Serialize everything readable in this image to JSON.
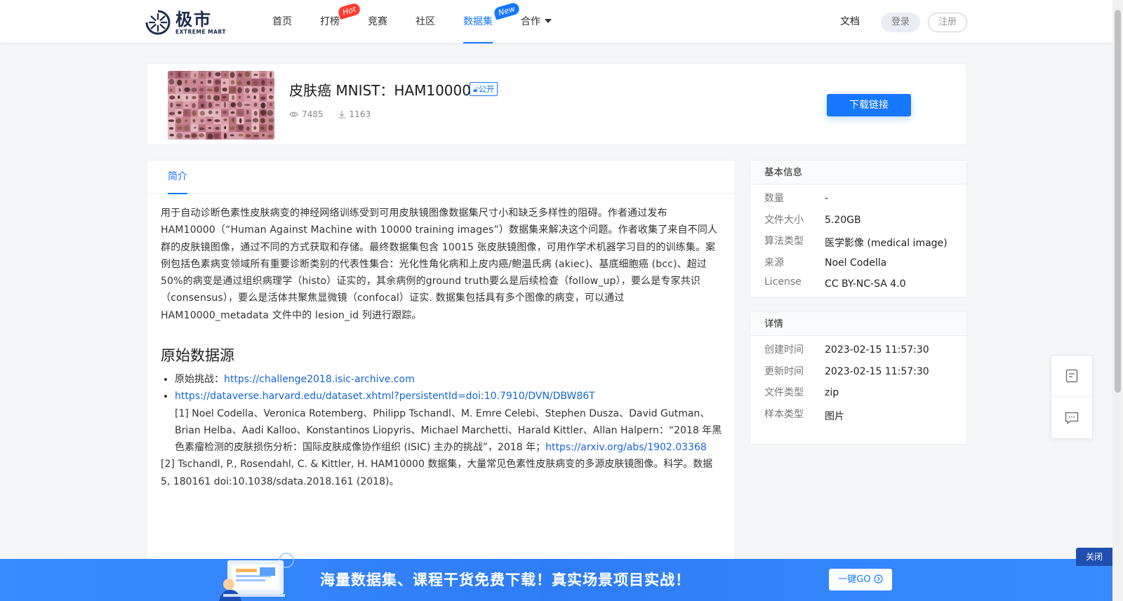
{
  "header": {
    "logo_cn": "极市",
    "logo_en": "EXTREME MART",
    "nav": [
      {
        "label": "首页"
      },
      {
        "label": "打榜",
        "badge": "Hot"
      },
      {
        "label": "竞赛"
      },
      {
        "label": "社区"
      },
      {
        "label": "数据集",
        "badge": "New",
        "active": true
      },
      {
        "label": "合作"
      }
    ],
    "docs": "文档",
    "login": "登录",
    "register": "注册"
  },
  "dataset": {
    "title": "皮肤癌 MNIST：HAM10000",
    "public_tag": "公开",
    "views": "7485",
    "downloads": "1163",
    "download_button": "下载链接"
  },
  "main": {
    "tab": "简介",
    "description": "用于自动诊断色素性皮肤病变的神经网络训练受到可用皮肤镜图像数据集尺寸小和缺乏多样性的阻碍。作者通过发布 HAM10000（“Human Against Machine with 10000 training images”）数据集来解决这个问题。作者收集了来自不同人群的皮肤镜图像，通过不同的方式获取和存储。最终数据集包含 10015 张皮肤镜图像，可用作学术机器学习目的的训练集。案例包括色素病变领域所有重要诊断类别的代表性集合：光化性角化病和上皮内癌/鲍温氏病 (akiec)、基底细胞癌 (bcc)、超过50%的病变是通过组织病理学（histo）证实的，其余病例的ground truth要么是后续检查（follow_up），要么是专家共识（consensus），要么是活体共聚焦显微镜（confocal）证实. 数据集包括具有多个图像的病变，可以通过 HAM10000_metadata 文件中的 lesion_id 列进行跟踪。",
    "source_heading": "原始数据源",
    "source1_label": "原始挑战：",
    "source1_link": "https://challenge2018.isic-archive.com",
    "source2_link": "https://dataverse.harvard.edu/dataset.xhtml?persistentId=doi:10.7910/DVN/DBW86T",
    "ref1_text": "[1] Noel Codella、Veronica Rotemberg、Philipp Tschandl、M. Emre Celebi、Stephen Dusza、David Gutman、Brian Helba、Aadi Kalloo、Konstantinos Liopyris、Michael Marchetti、Harald Kittler、Allan Halpern：“2018 年黑色素瘤检测的皮肤损伤分析：国际皮肤成像协作组织 (ISIC) 主办的挑战”，2018 年；",
    "ref1_link": "https://arxiv.org/abs/1902.03368",
    "ref2_text": "[2] Tschandl, P., Rosendahl, C. & Kittler, H. HAM10000 数据集，大量常见色素性皮肤病变的多源皮肤镜图像。科学。数据 5, 180161 doi:10.1038/sdata.2018.161 (2018)。"
  },
  "basic_info": {
    "heading": "基本信息",
    "rows": [
      {
        "key": "数量",
        "value": "-"
      },
      {
        "key": "文件大小",
        "value": "5.20GB"
      },
      {
        "key": "算法类型",
        "value": "医学影像 (medical image)"
      },
      {
        "key": "来源",
        "value": "Noel Codella",
        "link": true
      },
      {
        "key": "License",
        "value": "CC BY-NC-SA 4.0"
      }
    ]
  },
  "details": {
    "heading": "详情",
    "rows": [
      {
        "key": "创建时间",
        "value": "2023-02-15 11:57:30"
      },
      {
        "key": "更新时间",
        "value": "2023-02-15 11:57:30"
      },
      {
        "key": "文件类型",
        "value": "zip"
      },
      {
        "key": "样本类型",
        "value": "图片"
      }
    ]
  },
  "float_tools": [
    "document-icon",
    "chat-icon"
  ],
  "banner": {
    "text": "海量数据集、课程干货免费下载！真实场景项目实战！",
    "go_button": "一键GO",
    "close": "关闭"
  },
  "colors": {
    "accent": "#1677ff",
    "hot_badge": "#ff3b30",
    "banner": "#2f7df6"
  }
}
